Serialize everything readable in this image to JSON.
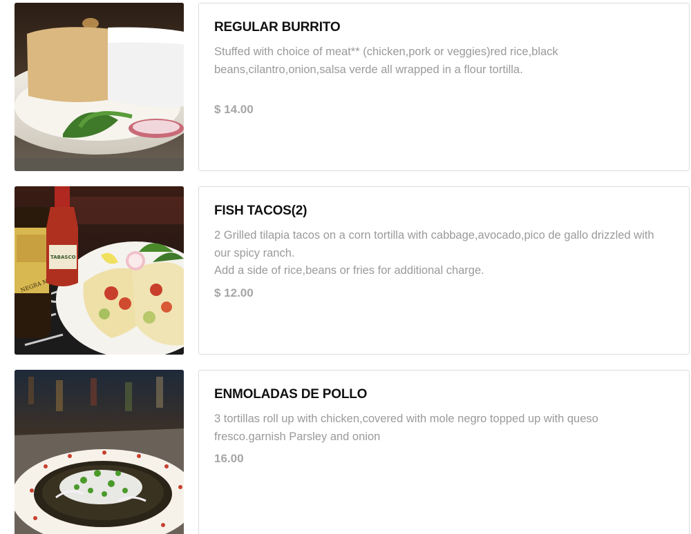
{
  "menu": {
    "items": [
      {
        "title": "REGULAR BURRITO",
        "description": [
          "Stuffed with choice of meat** (chicken,pork or veggies)red rice,black beans,cilantro,onion,salsa verde all wrapped in a flour tortilla."
        ],
        "price": "$ 14.00"
      },
      {
        "title": "FISH TACOS(2)",
        "description": [
          "2 Grilled tilapia tacos on a corn tortilla with cabbage,avocado,pico de gallo drizzled with our spicy ranch.",
          "Add a side of rice,beans or fries for additional charge."
        ],
        "price": "$ 12.00",
        "photo_labels": [
          "TABASCO",
          "NEGRA MODELO"
        ]
      },
      {
        "title": "ENMOLADAS DE POLLO",
        "description": [
          "3 tortillas roll up with chicken,covered with mole negro topped up with queso fresco.garnish Parsley and onion"
        ],
        "price": "16.00"
      }
    ]
  }
}
